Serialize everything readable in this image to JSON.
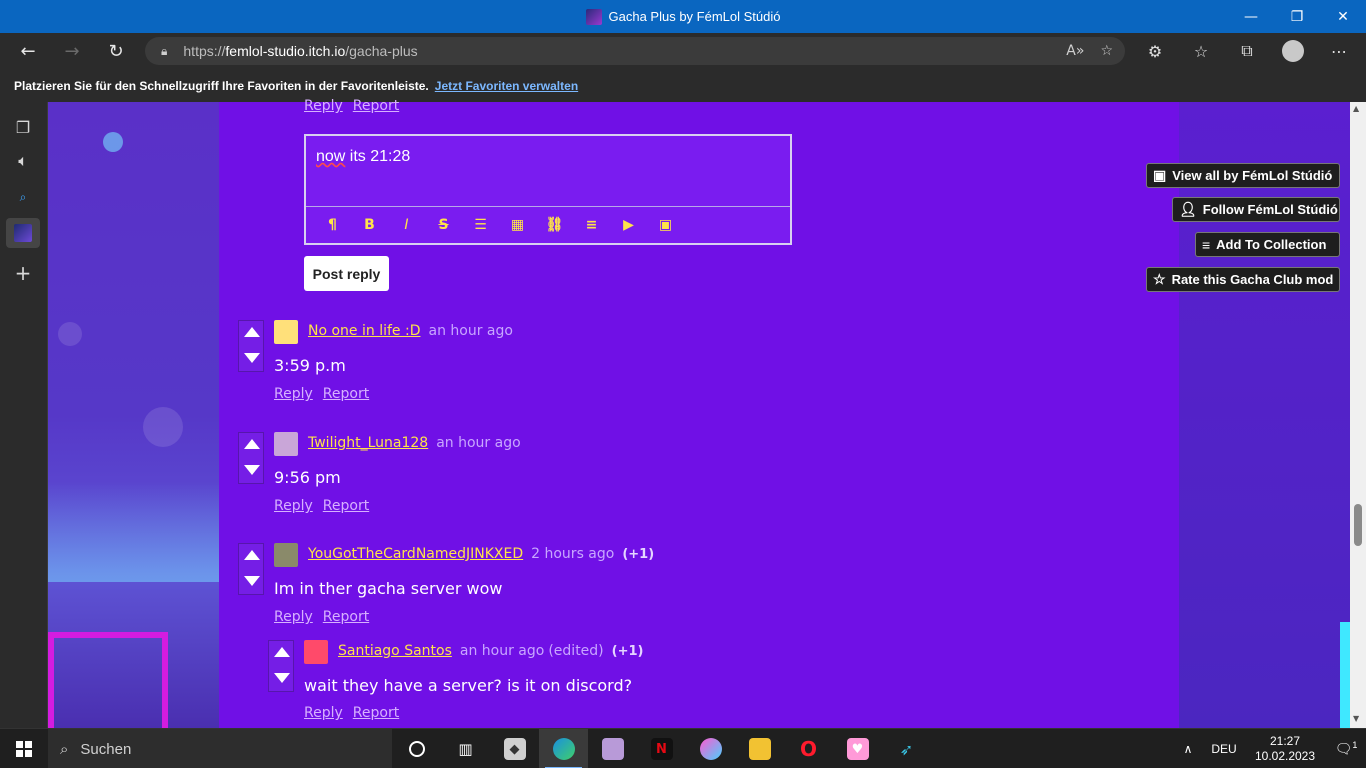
{
  "window": {
    "title": "Gacha Plus by FémLol Stúdió",
    "controls": {
      "minimize": "—",
      "restore": "❐",
      "close": "✕"
    }
  },
  "browser": {
    "url_scheme": "https://",
    "url_host": "femlol-studio.itch.io",
    "url_path": "/gacha-plus",
    "read_aloud_icon": "A»",
    "favorites_bar_message": "Platzieren Sie für den Schnellzugriff Ihre Favoriten in der Favoritenleiste.",
    "favorites_bar_link": "Jetzt Favoriten verwalten"
  },
  "editor": {
    "text_prefix": "now",
    "text_suffix": " its 21:28",
    "tools": [
      "¶",
      "B",
      "I",
      "S",
      "☰",
      "▦",
      "⛓",
      "≡",
      "▶",
      "▣"
    ],
    "post_button": "Post reply"
  },
  "actions": {
    "reply": "Reply",
    "report": "Report"
  },
  "comments": [
    {
      "user": "No one in life :D",
      "time": "an hour ago",
      "edited": "",
      "score": "",
      "text": "3:59 p.m",
      "avatar_color": "#ffe07a"
    },
    {
      "user": "Twilight_Luna128",
      "time": "an hour ago",
      "edited": "",
      "score": "",
      "text": "9:56 pm",
      "avatar_color": "#c9a6d8"
    },
    {
      "user": "YouGotTheCardNamedJINKXED",
      "time": "2 hours ago",
      "edited": "",
      "score": "(+1)",
      "text": "Im in ther gacha server wow",
      "avatar_color": "#8a8a6a"
    },
    {
      "user": "Santiago Santos",
      "time": "an hour ago",
      "edited": "(edited)",
      "score": "(+1)",
      "text": "wait they have a server? is it on discord?",
      "avatar_color": "#ff4a6a"
    }
  ],
  "side_buttons": {
    "view_all": "View all by FémLol Stúdió",
    "follow": "Follow FémLol Stúdió",
    "add_collection": "Add To Collection",
    "rate": "Rate this Gacha Club mod"
  },
  "taskbar": {
    "search_placeholder": "Suchen",
    "language": "DEU",
    "time": "21:27",
    "date": "10.02.2023",
    "notification_count": "1"
  },
  "colors": {
    "page_purple": "#7010e6",
    "username_yellow": "#ffe34a",
    "link_lilac": "#d7b0ff",
    "titlebar_blue": "#0a66c0"
  }
}
